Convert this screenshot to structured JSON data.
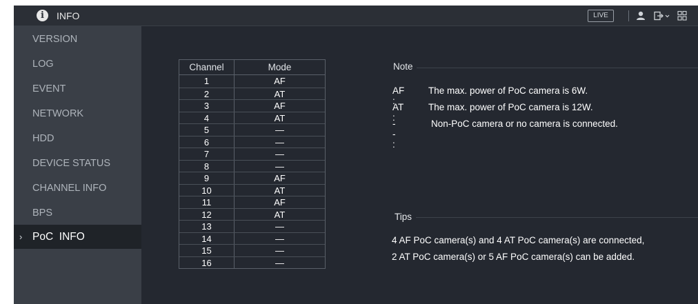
{
  "header": {
    "title": "INFO",
    "live_label": "LIVE"
  },
  "sidebar": {
    "items": [
      {
        "label": "VERSION"
      },
      {
        "label": "LOG"
      },
      {
        "label": "EVENT"
      },
      {
        "label": "NETWORK"
      },
      {
        "label": "HDD"
      },
      {
        "label": "DEVICE STATUS"
      },
      {
        "label": "CHANNEL INFO"
      },
      {
        "label": "BPS"
      },
      {
        "label": "PoC  INFO",
        "selected": true
      }
    ],
    "active_chevron": "›"
  },
  "table": {
    "headers": {
      "channel": "Channel",
      "mode": "Mode"
    },
    "rows": [
      {
        "channel": "1",
        "mode": "AF"
      },
      {
        "channel": "2",
        "mode": "AT"
      },
      {
        "channel": "3",
        "mode": "AF"
      },
      {
        "channel": "4",
        "mode": "AT"
      },
      {
        "channel": "5",
        "mode": "—"
      },
      {
        "channel": "6",
        "mode": "—"
      },
      {
        "channel": "7",
        "mode": "—"
      },
      {
        "channel": "8",
        "mode": "—"
      },
      {
        "channel": "9",
        "mode": "AF"
      },
      {
        "channel": "10",
        "mode": "AT"
      },
      {
        "channel": "11",
        "mode": "AF"
      },
      {
        "channel": "12",
        "mode": "AT"
      },
      {
        "channel": "13",
        "mode": "—"
      },
      {
        "channel": "14",
        "mode": "—"
      },
      {
        "channel": "15",
        "mode": "—"
      },
      {
        "channel": "16",
        "mode": "—"
      }
    ]
  },
  "note": {
    "title": "Note",
    "items": [
      {
        "key": "AF :",
        "text": "The max. power of PoC camera is 6W."
      },
      {
        "key": "AT :",
        "text": "The max. power of PoC camera is 12W."
      },
      {
        "key": "-- :",
        "text": "Non-PoC camera or no camera is connected."
      }
    ]
  },
  "tips": {
    "title": "Tips",
    "lines": [
      "4 AF PoC camera(s) and 4 AT PoC camera(s) are connected,",
      "2 AT PoC camera(s) or 5 AF PoC camera(s) can be added."
    ]
  },
  "icons": {
    "info": "info-icon",
    "user": "user-icon",
    "logout": "logout-icon",
    "grid": "grid-icon"
  },
  "colors": {
    "sidebar_bg": "#3a3f47",
    "content_bg": "#242830",
    "active_item_bg": "#1f2328",
    "titlebar_bg": "#2b2f36"
  }
}
